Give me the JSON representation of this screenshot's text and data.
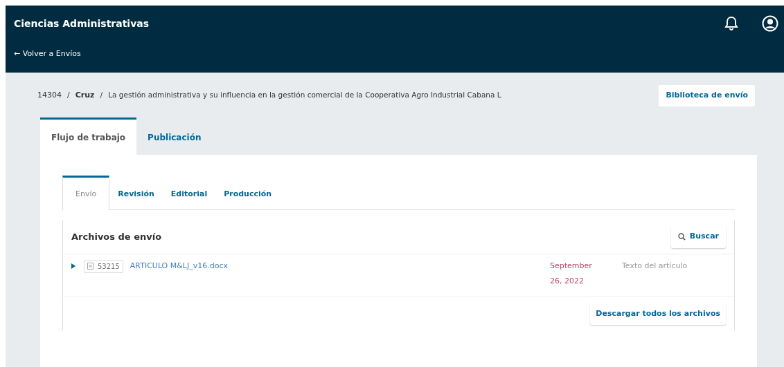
{
  "header": {
    "title": "Ciencias Administrativas",
    "back_link": "← Volver a Envíos"
  },
  "breadcrumb": {
    "id": "14304",
    "separator_1": "/",
    "author": "Cruz",
    "separator_2": "/",
    "title": "La gestión administrativa y su influencia en la gestión comercial de la Cooperativa Agro Industrial Cabana L",
    "library_button": "Biblioteca de envío"
  },
  "tabs": [
    {
      "label": "Flujo de trabajo",
      "selected": true
    },
    {
      "label": "Publicación",
      "selected": false
    }
  ],
  "stage_tabs": [
    {
      "label": "Envío",
      "selected": true
    },
    {
      "label": "Revisión",
      "selected": false
    },
    {
      "label": "Editorial",
      "selected": false
    },
    {
      "label": "Producción",
      "selected": false
    }
  ],
  "files_panel": {
    "title": "Archivos de envío",
    "search_button": "Buscar",
    "files": [
      {
        "expanded": false,
        "id": "53215",
        "name": "ARTICULO M&LJ_v16.docx",
        "date": "September 26, 2022",
        "type": "Texto del artículo"
      }
    ],
    "download_button": "Descargar todos los archivos"
  }
}
